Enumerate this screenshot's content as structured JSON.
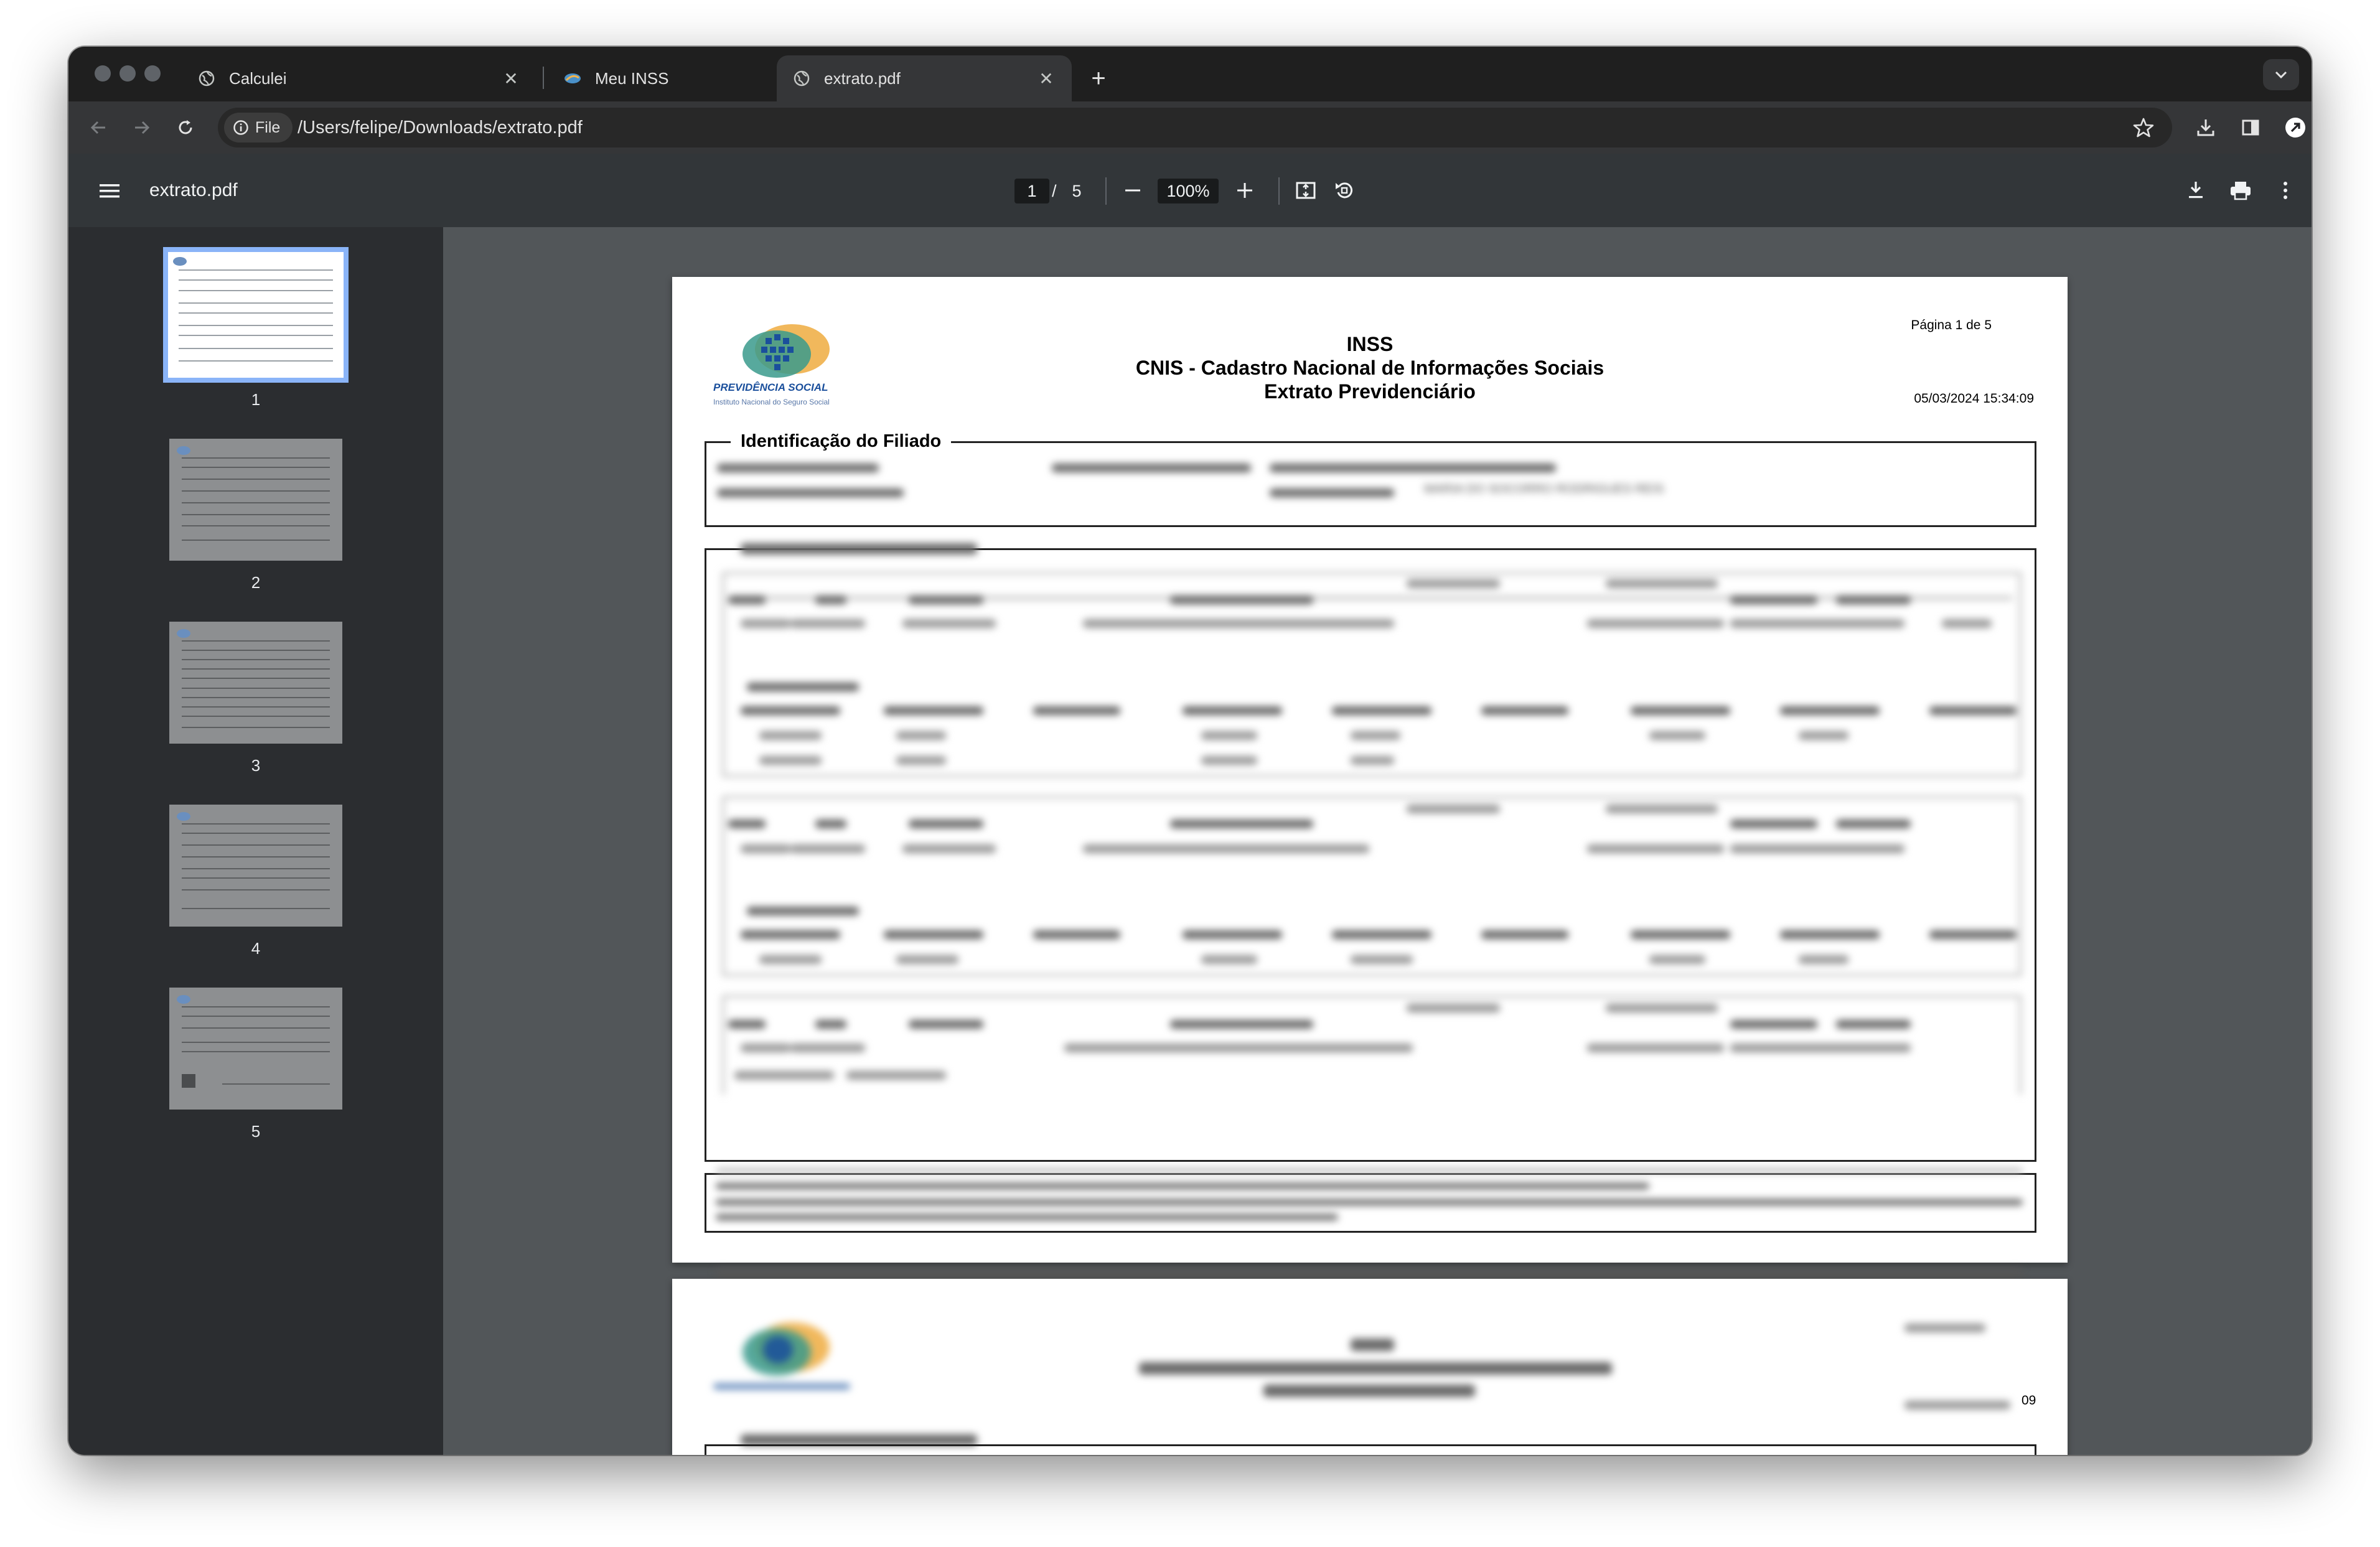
{
  "browser": {
    "tabs": [
      {
        "label": "Calculei",
        "active": false
      },
      {
        "label": "Meu INSS",
        "active": false
      },
      {
        "label": "extrato.pdf",
        "active": true
      }
    ],
    "address": {
      "chip_label": "File",
      "url": "/Users/felipe/Downloads/extrato.pdf"
    }
  },
  "pdf_viewer": {
    "file_title": "extrato.pdf",
    "current_page": "1",
    "page_separator": "/",
    "total_pages": "5",
    "zoom": "100%",
    "thumbnails": [
      "1",
      "2",
      "3",
      "4",
      "5"
    ]
  },
  "document": {
    "page_label": "Página 1 de 5",
    "org": "INSS",
    "title_line1": "CNIS - Cadastro Nacional de Informações Sociais",
    "title_line2": "Extrato Previdenciário",
    "datetime": "05/03/2024 15:34:09",
    "logo_name": "PREVIDÊNCIA SOCIAL",
    "logo_sub": "Instituto Nacional do Seguro Social",
    "section_title": "Identificação do Filiado",
    "blurred_mother_name": "MARIA DO SOCORRO RODRIGUES REIS",
    "page2_datetime_tail": "09"
  },
  "colors": {
    "viewport_bg": "#525659",
    "sidebar_bg": "#2b2d30",
    "toolbar_bg": "#323639",
    "thumb_active_border": "#8ab4f8"
  }
}
